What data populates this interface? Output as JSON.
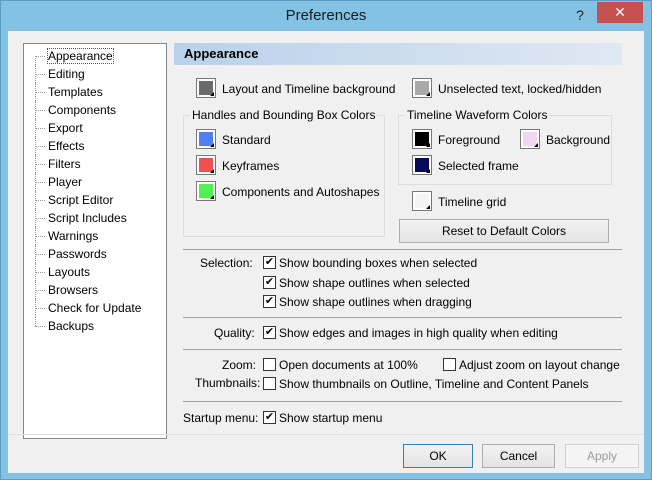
{
  "window": {
    "title": "Preferences",
    "help": "?",
    "close": "✕"
  },
  "tree": {
    "items": [
      "Appearance",
      "Editing",
      "Templates",
      "Components",
      "Export",
      "Effects",
      "Filters",
      "Player",
      "Script Editor",
      "Script Includes",
      "Warnings",
      "Passwords",
      "Layouts",
      "Browsers",
      "Check for Update",
      "Backups"
    ]
  },
  "panel": {
    "title": "Appearance",
    "layout_bg": "Layout and Timeline background",
    "unselected": "Unselected text, locked/hidden",
    "handles_group": "Handles and Bounding Box Colors",
    "standard": "Standard",
    "keyframes": "Keyframes",
    "components": "Components and Autoshapes",
    "waveform_group": "Timeline Waveform Colors",
    "foreground": "Foreground",
    "background": "Background",
    "selected_frame": "Selected frame",
    "timeline_grid": "Timeline grid",
    "reset": "Reset to Default Colors",
    "selection_label": "Selection:",
    "sel1": "Show bounding boxes when selected",
    "sel2": "Show shape outlines when selected",
    "sel3": "Show shape outlines when dragging",
    "quality_label": "Quality:",
    "quality": "Show edges and images in high quality when editing",
    "zoom_label": "Zoom:",
    "thumbs_label": "Thumbnails:",
    "zoom1": "Open documents at 100%",
    "zoom2": "Adjust zoom on layout change",
    "thumbs": "Show thumbnails on Outline, Timeline and Content Panels",
    "startup_label": "Startup menu:",
    "startup": "Show startup menu"
  },
  "colors": {
    "layout_bg": "#6b6b6b",
    "unselected": "#a8a8a8",
    "standard": "#4f7ff0",
    "keyframes": "#f05050",
    "components": "#4ff04f",
    "foreground": "#000000",
    "background": "#f3d6f0",
    "selected_frame": "#0a0a5a",
    "timeline_grid": "#f4f4f4"
  },
  "checkbox_mark": "✔",
  "buttons": {
    "ok": "OK",
    "cancel": "Cancel",
    "apply": "Apply"
  }
}
